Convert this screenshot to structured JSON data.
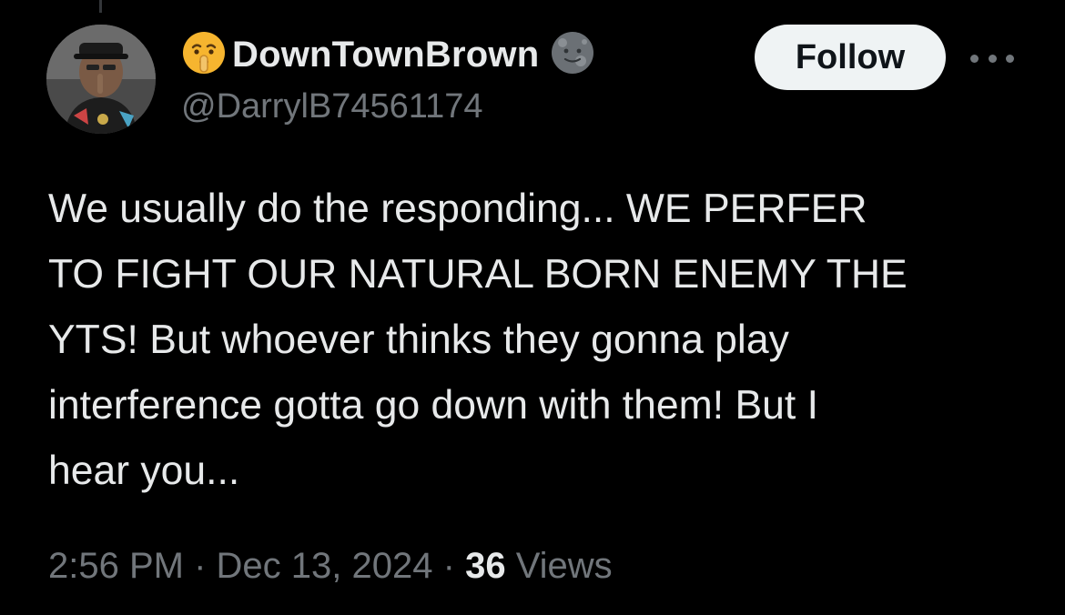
{
  "tweet": {
    "author": {
      "display_name": "DownTownBrown",
      "leading_emoji": "shushing-face-emoji",
      "badge_emoji": "new-moon-face-emoji",
      "handle": "@DarrylB74561174",
      "avatar": "user-avatar-photo"
    },
    "follow_label": "Follow",
    "more_icon": "more-options-icon",
    "text": "We usually do the responding...  WE PERFER\nTO FIGHT OUR NATURAL BORN ENEMY THE\nYTS! But whoever thinks they gonna play\ninterference gotta go down with them! But I\nhear you...",
    "time": "2:56 PM",
    "separator": "·",
    "date": "Dec 13, 2024",
    "views_count": "36",
    "views_label": "Views"
  },
  "colors": {
    "background": "#000000",
    "primary_text": "#e7e9ea",
    "secondary_text": "#71767b",
    "follow_button_bg": "#eff3f4",
    "follow_button_text": "#0f1419"
  }
}
